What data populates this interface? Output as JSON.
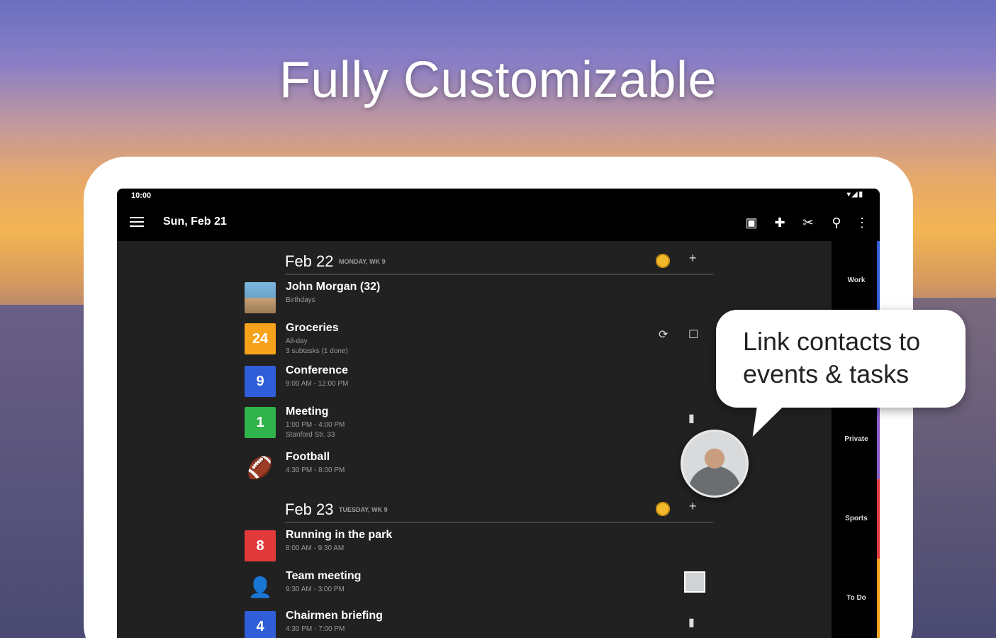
{
  "headline": "Fully Customizable",
  "status_bar": {
    "time": "10:00"
  },
  "toolbar": {
    "title": "Sun, Feb 21"
  },
  "days": [
    {
      "date": "Feb 22",
      "sub": "MONDAY, WK 9",
      "events": [
        {
          "title": "John Morgan (32)",
          "sub": "Birthdays",
          "sub2": "",
          "icon_text": ""
        },
        {
          "title": "Groceries",
          "sub": "All-day",
          "sub2": "3 subtasks (1 done)",
          "icon_text": "24",
          "color": "#f7a21b"
        },
        {
          "title": "Conference",
          "sub": "9:00 AM - 12:00 PM",
          "sub2": "",
          "icon_text": "9",
          "color": "#2f5ed8"
        },
        {
          "title": "Meeting",
          "sub": "1:00 PM - 4:00 PM",
          "sub2": "Stanford Str. 33",
          "icon_text": "1",
          "color": "#2fb34a"
        },
        {
          "title": "Football",
          "sub": "4:30 PM - 8:00 PM",
          "sub2": "",
          "icon_text": ""
        }
      ]
    },
    {
      "date": "Feb 23",
      "sub": "TUESDAY, WK 9",
      "events": [
        {
          "title": "Running in the park",
          "sub": "8:00 AM - 9:30 AM",
          "sub2": "",
          "icon_text": "8",
          "color": "#e23a3a"
        },
        {
          "title": "Team meeting",
          "sub": "9:30 AM - 3:00 PM",
          "sub2": "",
          "icon_text": ""
        },
        {
          "title": "Chairmen briefing",
          "sub": "4:30 PM - 7:00 PM",
          "sub2": "",
          "icon_text": "4",
          "color": "#2f5ed8"
        }
      ]
    }
  ],
  "sidebar": {
    "labels": [
      "Work",
      "Private",
      "Sports",
      "To Do"
    ],
    "colors": [
      "#2f5ed8",
      "#8a5cc8",
      "#e23a3a",
      "#f7a21b"
    ]
  },
  "callout": {
    "line1": "Link contacts to",
    "line2": "events & tasks"
  }
}
